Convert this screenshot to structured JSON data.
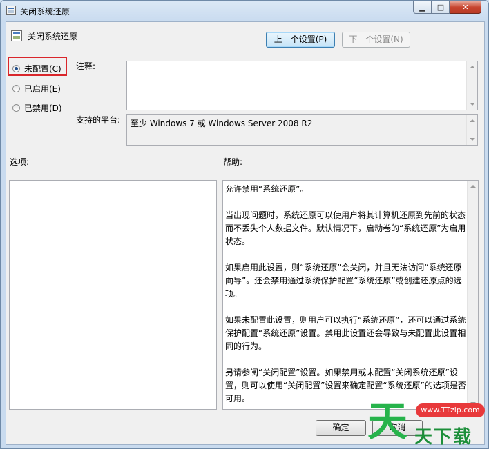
{
  "window": {
    "title": "关闭系统还原",
    "min_glyph": "▁",
    "max_glyph": "□",
    "close_glyph": "✕"
  },
  "policy": {
    "title": "关闭系统还原",
    "prev_button": "上一个设置(P)",
    "next_button": "下一个设置(N)"
  },
  "radios": [
    {
      "label": "未配置(C)",
      "selected": true
    },
    {
      "label": "已启用(E)",
      "selected": false
    },
    {
      "label": "已禁用(D)",
      "selected": false
    }
  ],
  "comment_label": "注释:",
  "platform_label": "支持的平台:",
  "platform_value": "至少 Windows 7 或 Windows Server 2008 R2",
  "options_label": "选项:",
  "help_label": "帮助:",
  "help_paragraphs": [
    "允许禁用“系统还原”。",
    "当出现问题时，系统还原可以使用户将其计算机还原到先前的状态而不丢失个人数据文件。默认情况下，启动卷的“系统还原”为启用状态。",
    "如果启用此设置，则“系统还原”会关闭，并且无法访问“系统还原向导”。还会禁用通过系统保护配置“系统还原”或创建还原点的选项。",
    "如果未配置此设置，则用户可以执行“系统还原”，还可以通过系统保护配置“系统还原”设置。禁用此设置还会导致与未配置此设置相同的行为。",
    "另请参阅“关闭配置”设置。如果禁用或未配置“关闭系统还原”设置，则可以使用“关闭配置”设置来确定配置“系统还原”的选项是否可用。"
  ],
  "buttons": {
    "ok": "确定",
    "cancel": "取消"
  },
  "watermark": {
    "logo": "天",
    "url": "www.TTzip.com",
    "text": "天下载"
  },
  "colors": {
    "highlight": "#d9262b",
    "watermark_green": "#27b34b"
  }
}
